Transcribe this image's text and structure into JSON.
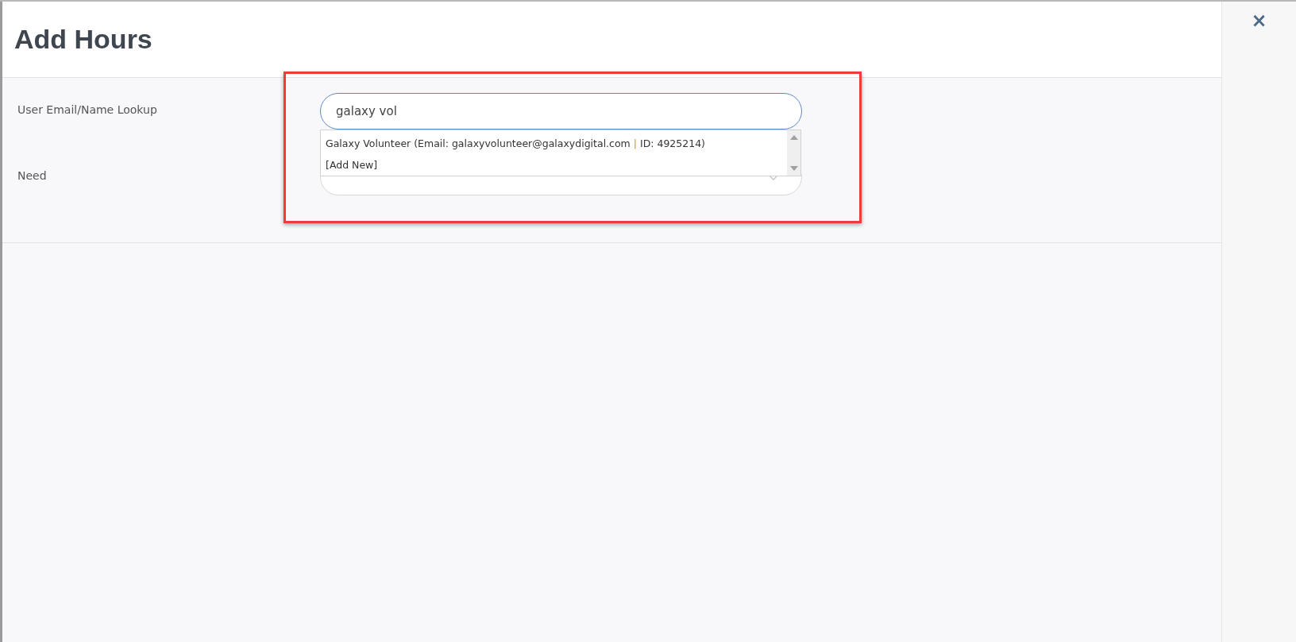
{
  "dialog": {
    "title": "Add Hours",
    "close": "×",
    "highlight": true
  },
  "fields": [
    {
      "kind": "lookup",
      "label": "User Email/Name Lookup",
      "value": "galaxy vol",
      "focused": true,
      "suggestions": [
        {
          "name": "Galaxy Volunteer (Email: galaxyvolunteer@galaxydigital.com",
          "separator": "|",
          "id": "ID: 4925214)"
        },
        {
          "name": "[Add New]"
        }
      ]
    },
    {
      "kind": "select",
      "label": "Need"
    }
  ]
}
